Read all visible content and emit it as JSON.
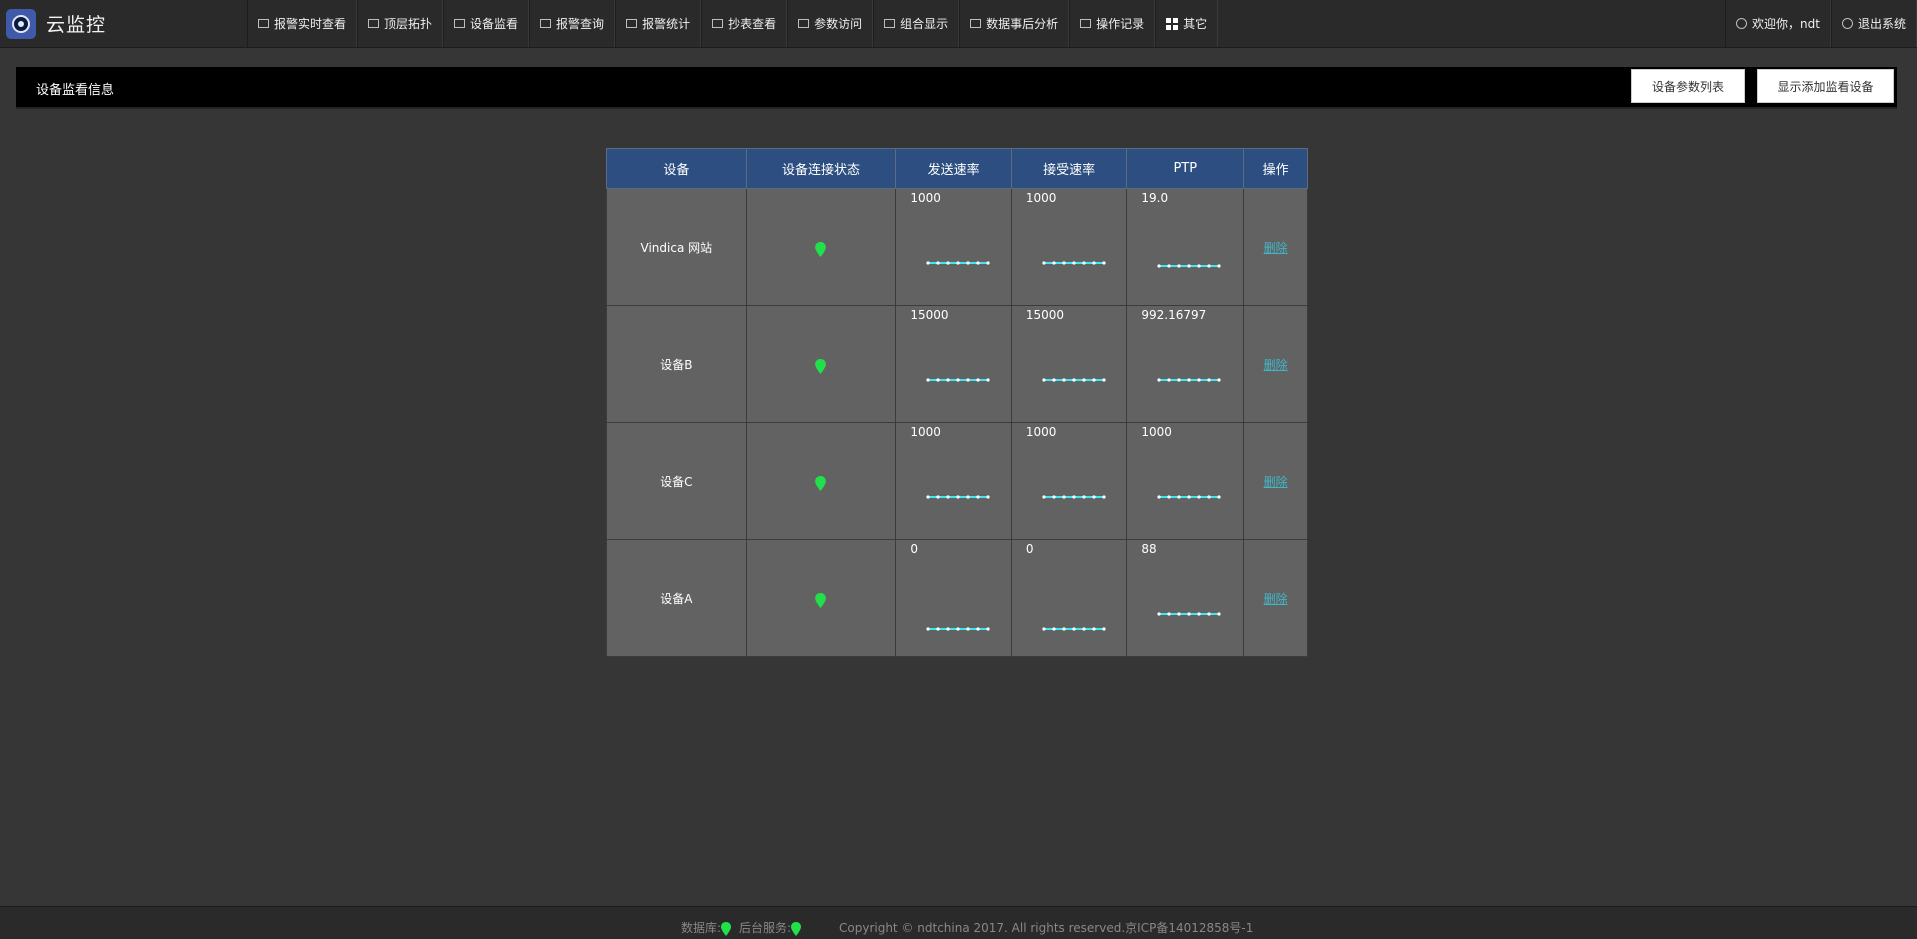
{
  "app": {
    "title": "云监控"
  },
  "nav": [
    {
      "label": "报警实时查看",
      "icon": "monitor-icon"
    },
    {
      "label": "顶层拓扑",
      "icon": "topology-icon"
    },
    {
      "label": "设备监看",
      "icon": "device-icon"
    },
    {
      "label": "报警查询",
      "icon": "speaker-icon"
    },
    {
      "label": "报警统计",
      "icon": "chart-icon"
    },
    {
      "label": "抄表查看",
      "icon": "meter-icon"
    },
    {
      "label": "参数访问",
      "icon": "params-icon"
    },
    {
      "label": "组合显示",
      "icon": "grid-icon"
    },
    {
      "label": "数据事后分析",
      "icon": "analysis-icon"
    },
    {
      "label": "操作记录",
      "icon": "log-icon"
    },
    {
      "label": "其它",
      "icon": "apps-icon"
    }
  ],
  "user": {
    "welcome": "欢迎你，ndt",
    "logout": "退出系统"
  },
  "section": {
    "title": "设备监看信息",
    "btn_param_list": "设备参数列表",
    "btn_show_add": "显示添加监看设备"
  },
  "table": {
    "headers": [
      "设备",
      "设备连接状态",
      "发送速率",
      "接受速率",
      "PTP",
      "操作"
    ],
    "rows": [
      {
        "device": "Vindica 网站",
        "send": "1000",
        "recv": "1000",
        "ptp": "19.0",
        "action": "删除"
      },
      {
        "device": "设备B",
        "send": "15000",
        "recv": "15000",
        "ptp": "992.16797",
        "action": "删除"
      },
      {
        "device": "设备C",
        "send": "1000",
        "recv": "1000",
        "ptp": "1000",
        "action": "删除"
      },
      {
        "device": "设备A",
        "send": "0",
        "recv": "0",
        "ptp": "88",
        "action": "删除"
      }
    ]
  },
  "colors": {
    "header_bg": "#2c4e80",
    "status_green": "#22e04a",
    "spark": "#3fe6ef",
    "link": "#3fb7c8"
  },
  "footer": {
    "db_label": "数据库:",
    "svc_label": "后台服务:",
    "copyright": "Copyright © ndtchina 2017. All rights reserved.京ICP备14012858号-1"
  }
}
